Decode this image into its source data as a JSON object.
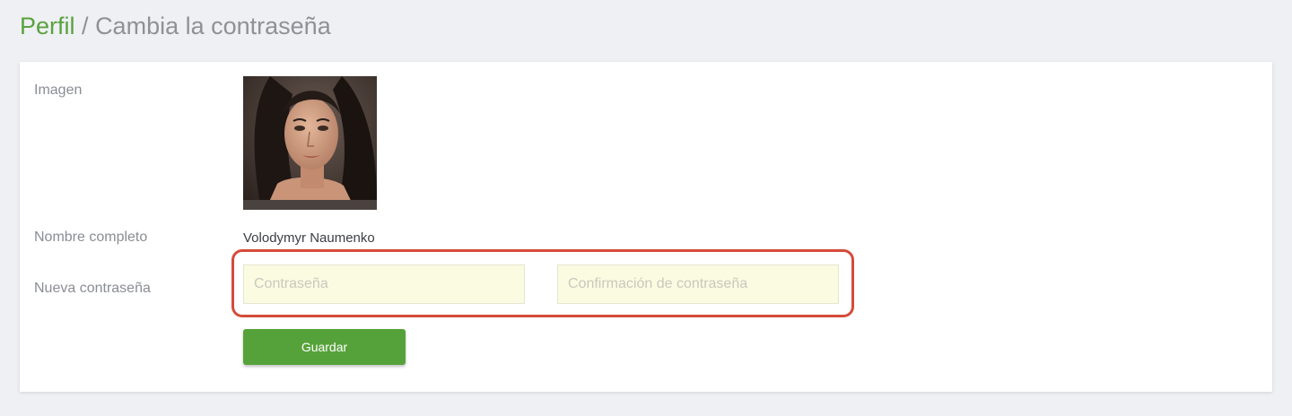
{
  "breadcrumb": {
    "section": "Perfil",
    "separator": "/",
    "current": "Cambia la contraseña"
  },
  "profile": {
    "image_label": "Imagen",
    "fullname_label": "Nombre completo",
    "fullname_value": "Volodymyr Naumenko",
    "new_password_label": "Nueva contraseña",
    "password_placeholder": "Contraseña",
    "password_value": "",
    "confirm_placeholder": "Confirmación de contraseña",
    "confirm_value": "",
    "save_label": "Guardar"
  },
  "colors": {
    "accent_green": "#56a23a",
    "highlight_red": "#d54b3a",
    "input_background": "#fbfbe2",
    "page_background": "#eef0f4"
  }
}
